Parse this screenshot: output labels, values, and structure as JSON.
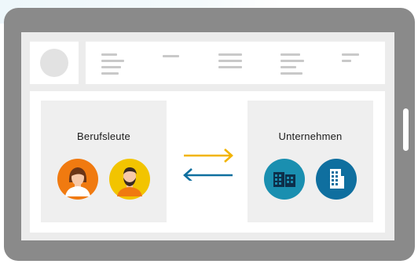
{
  "screen": {
    "left_group": {
      "title": "Berufsleute"
    },
    "right_group": {
      "title": "Unternehmen"
    }
  },
  "icons": {
    "avatar": "avatar-placeholder-icon",
    "woman": "woman-person-icon",
    "man": "bearded-man-person-icon",
    "company_small": "office-buildings-icon",
    "company_tall": "tall-building-icon",
    "arrow_right": "arrow-right-icon",
    "arrow_left": "arrow-left-icon"
  },
  "colors": {
    "tablet": "#8a8a8a",
    "orange": "#f07a10",
    "yellow": "#f2c400",
    "teal": "#1a8fb0",
    "blue": "#0f6f9f"
  }
}
